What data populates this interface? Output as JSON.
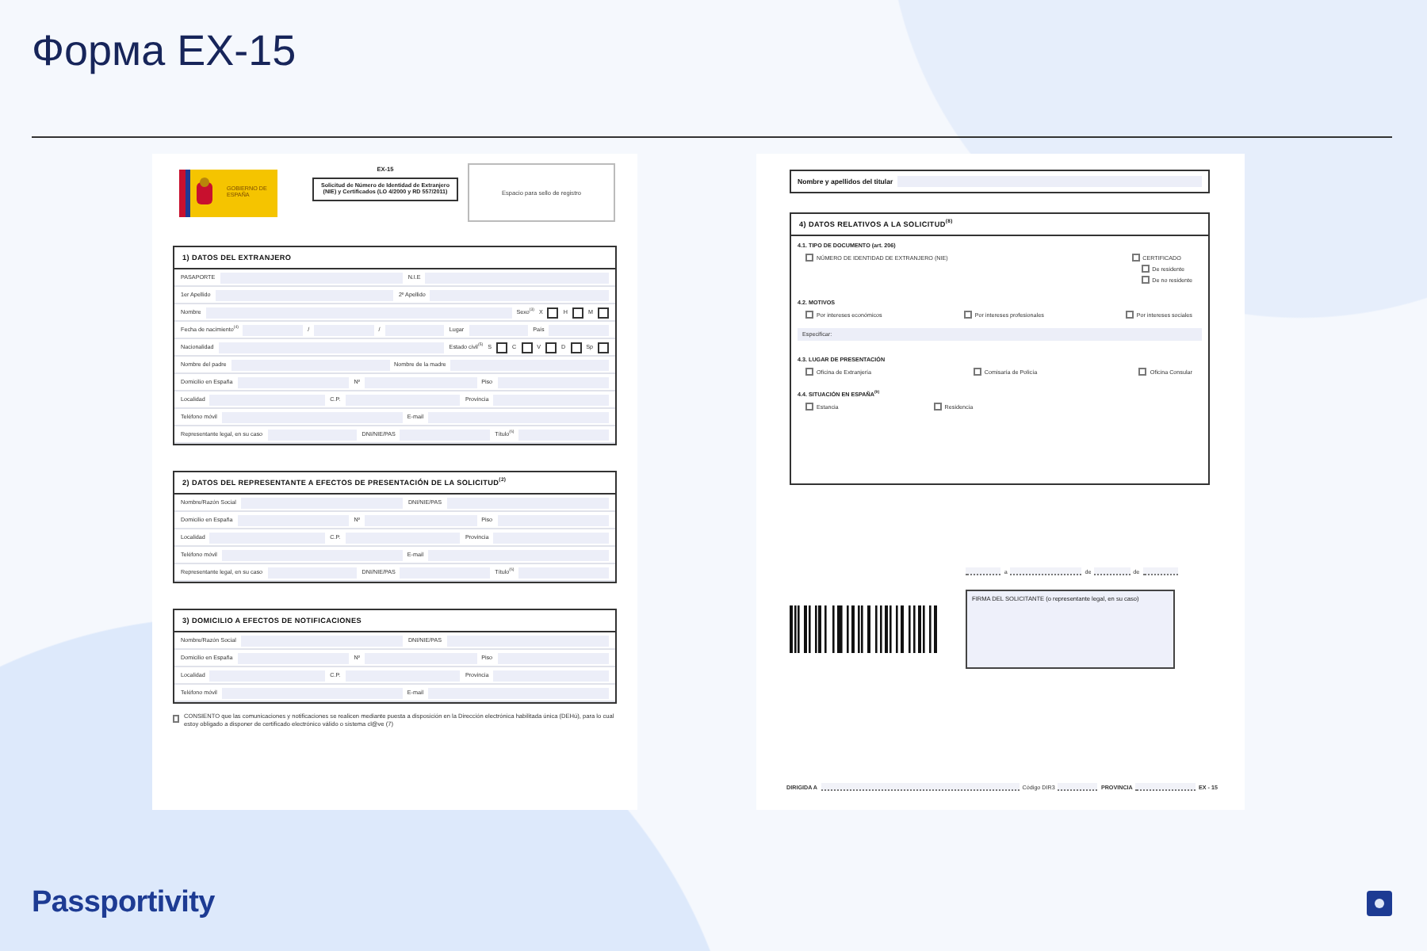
{
  "title": "Форма EX-15",
  "left_page": {
    "form_code": "EX-15",
    "logo_text": "GOBIERNO DE ESPAÑA",
    "form_title": "Solicitud de Número de Identidad de Extranjero (NIE) y Certificados (LO 4/2000 y RD 557/2011)",
    "registry_box": "Espacio para sello de registro",
    "sections": [
      {
        "heading": "1) DATOS DEL EXTRANJERO",
        "rows": [
          [
            {
              "label": "PASAPORTE"
            },
            {
              "label": "N.I.E"
            }
          ],
          [
            {
              "label": "1er Apellido"
            },
            {
              "label": "2º Apellido"
            }
          ],
          [
            {
              "label": "Nombre"
            },
            {
              "label": "Sexo$^{(3)}$",
              "options": [
                {
                  "label": "X",
                  "checked": false
                },
                {
                  "label": "H",
                  "checked": false
                },
                {
                  "label": "M",
                  "checked": false
                }
              ]
            }
          ],
          [
            {
              "label": "Fecha de nacimiento$^{(4)}$"
            },
            {
              "label": "/"
            },
            {
              "label": "/"
            },
            {
              "label": "Lugar"
            },
            {
              "label": "País"
            }
          ],
          [
            {
              "label": "Nacionalidad"
            },
            {
              "label": "Estado civil$^{(5)}$",
              "options": [
                {
                  "label": "S",
                  "checked": false
                },
                {
                  "label": "C",
                  "checked": false
                },
                {
                  "label": "V",
                  "checked": false
                },
                {
                  "label": "D",
                  "checked": false
                },
                {
                  "label": "Sp",
                  "checked": false
                }
              ]
            }
          ],
          [
            {
              "label": "Nombre del padre"
            },
            {
              "label": "Nombre de la madre"
            }
          ],
          [
            {
              "label": "Domicilio en España"
            },
            {
              "label": "Nº"
            },
            {
              "label": "Piso"
            }
          ],
          [
            {
              "label": "Localidad"
            },
            {
              "label": "C.P."
            },
            {
              "label": "Provincia"
            }
          ],
          [
            {
              "label": "Teléfono móvil"
            },
            {
              "label": "E-mail"
            }
          ],
          [
            {
              "label": "Representante legal, en su caso"
            },
            {
              "label": "DNI/NIE/PAS"
            },
            {
              "label": "Título$^{(6)}$"
            }
          ]
        ]
      },
      {
        "heading": "2) DATOS DEL REPRESENTANTE A EFECTOS DE PRESENTACIÓN DE LA SOLICITUD$^{(2)}$",
        "rows": [
          [
            {
              "label": "Nombre/Razón Social"
            },
            {
              "label": "DNI/NIE/PAS"
            }
          ],
          [
            {
              "label": "Domicilio en España"
            },
            {
              "label": "Nº"
            },
            {
              "label": "Piso"
            }
          ],
          [
            {
              "label": "Localidad"
            },
            {
              "label": "C.P."
            },
            {
              "label": "Provincia"
            }
          ],
          [
            {
              "label": "Teléfono móvil"
            },
            {
              "label": "E-mail"
            }
          ],
          [
            {
              "label": "Representante legal, en su caso"
            },
            {
              "label": "DNI/NIE/PAS"
            },
            {
              "label": "Título$^{(6)}$"
            }
          ]
        ]
      },
      {
        "heading": "3) DOMICILIO A EFECTOS DE NOTIFICACIONES",
        "rows": [
          [
            {
              "label": "Nombre/Razón Social"
            },
            {
              "label": "DNI/NIE/PAS"
            }
          ],
          [
            {
              "label": "Domicilio en España"
            },
            {
              "label": "Nº"
            },
            {
              "label": "Piso"
            }
          ],
          [
            {
              "label": "Localidad"
            },
            {
              "label": "C.P."
            },
            {
              "label": "Provincia"
            }
          ],
          [
            {
              "label": "Teléfono móvil"
            },
            {
              "label": "E-mail"
            }
          ]
        ]
      }
    ],
    "consent": {
      "checked": false,
      "text": "CONSIENTO que las comunicaciones y notificaciones se realicen mediante puesta a disposición en la Dirección electrónica habilitada única (DEHú), para lo cual estoy obligado a disponer de certificado electrónico válido o sistema cl@ve (7)"
    }
  },
  "right_page": {
    "holder_label": "Nombre y apellidos del titular",
    "section_heading": "4) DATOS RELATIVOS A LA SOLICITUD$^{(8)}$",
    "subsections": [
      {
        "heading": "4.1. TIPO DE DOCUMENTO (art. 206)",
        "kind": "split",
        "options": [
          {
            "label": "NÚMERO DE IDENTIDAD DE EXTRANJERO (NIE)",
            "checked": false
          },
          {
            "label": "CERTIFICADO",
            "checked": false,
            "children": [
              {
                "label": "De residente",
                "checked": false
              },
              {
                "label": "De no residente",
                "checked": false
              }
            ]
          }
        ]
      },
      {
        "heading": "4.2. MOTIVOS",
        "kind": "spread",
        "options": [
          {
            "label": "Por intereses económicos",
            "checked": false
          },
          {
            "label": "Por intereses profesionales",
            "checked": false
          },
          {
            "label": "Por intereses sociales",
            "checked": false
          }
        ],
        "specify": "Especificar:"
      },
      {
        "heading": "4.3. LUGAR DE PRESENTACIÓN",
        "kind": "spread",
        "options": [
          {
            "label": "Oficina de Extranjería",
            "checked": false
          },
          {
            "label": "Comisaría de Policía",
            "checked": false
          },
          {
            "label": "Oficina Consular",
            "checked": false
          }
        ]
      },
      {
        "heading": "4.4. SITUACIÓN EN ESPAÑA$^{(9)}$",
        "kind": "start",
        "options": [
          {
            "label": "Estancia",
            "checked": false
          },
          {
            "label": "Residencia",
            "checked": false
          }
        ]
      }
    ],
    "date_words": [
      "a",
      "de",
      "de"
    ],
    "signature": "FIRMA DEL SOLICITANTE (o representante legal, en su caso)",
    "footer": {
      "addressed_to": "DIRIGIDA A",
      "dir3": "Código DIR3",
      "province": "PROVINCIA",
      "code": "EX - 15"
    }
  },
  "brand": "Passportivity"
}
